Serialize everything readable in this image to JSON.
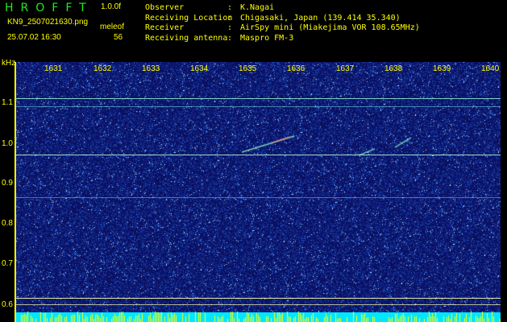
{
  "header": {
    "logo": "HROFFT",
    "version": "1.0.0f",
    "filename": "KN9_2507021630.png",
    "method": "meleof",
    "datetime": "25.07.02 16:30",
    "count": "56",
    "observer_label": "Observer",
    "observer": "K.Nagai",
    "location_label": "Receiving Location",
    "location": "Chigasaki, Japan (139.414 35.340)",
    "receiver_label": "Receiver",
    "receiver": "AirSpy mini (Miakejima VOR 108.65MHz)",
    "antenna_label": "Receiving antenna",
    "antenna": "Maspro FM-3",
    "separator": ":"
  },
  "axes": {
    "y_unit": "kHz",
    "x_ticks": [
      "1631",
      "1632",
      "1633",
      "1634",
      "1635",
      "1636",
      "1637",
      "1638",
      "1639",
      "1640"
    ],
    "y_ticks": [
      "1.1",
      "1.0",
      "0.9",
      "0.8",
      "0.7",
      "0.6"
    ]
  },
  "colors": {
    "background": "#0a0f5e",
    "text": "#ffff00",
    "logo": "#22e822",
    "bottom_bar": "#00e6ff"
  }
}
